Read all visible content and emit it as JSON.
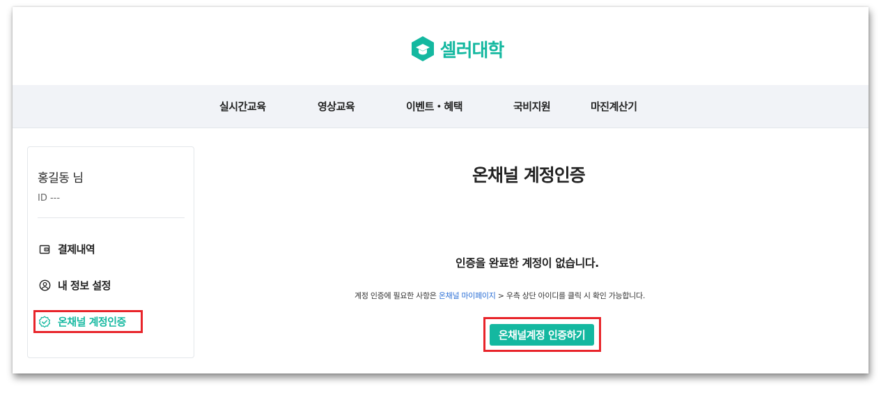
{
  "brand": {
    "name": "셀러대학",
    "color": "#14b8a0",
    "logo_icon": "graduation-cap-icon"
  },
  "nav": {
    "items": [
      {
        "label": "실시간교육"
      },
      {
        "label": "영상교육"
      },
      {
        "label": "이벤트・혜택"
      },
      {
        "label": "국비지원"
      },
      {
        "label": "마진계산기"
      }
    ]
  },
  "sidebar": {
    "user_name": "홍길동 님",
    "user_id": "ID ---",
    "menu": [
      {
        "label": "결제내역",
        "icon": "wallet-icon"
      },
      {
        "label": "내 정보 설정",
        "icon": "user-circle-icon"
      },
      {
        "label": "온채널 계정인증",
        "icon": "verified-badge-icon",
        "active": true
      }
    ]
  },
  "main": {
    "title": "온채널 계정인증",
    "empty_message": "인증을 완료한 계정이 없습니다.",
    "help_prefix": "계정 인증에 필요한 사항은 ",
    "help_link": "온채널 마이페이지",
    "help_suffix": " > 우측 상단 아이디를 클릭 시 확인 가능합니다.",
    "verify_button": "온채널계정 인증하기"
  },
  "colors": {
    "accent": "#14b8a0",
    "highlight_box": "#e8242a",
    "link": "#2b6fd6",
    "nav_bg": "#f1f3f7"
  }
}
